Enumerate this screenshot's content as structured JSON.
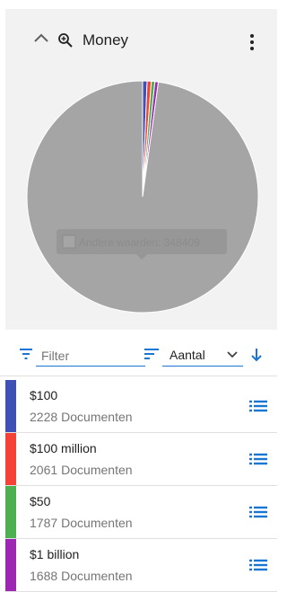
{
  "widget": {
    "title": "Money",
    "collapse_icon": "chevron-up-icon",
    "search_icon": "zoom-in-icon",
    "menu_icon": "more-vert-icon"
  },
  "pie": {
    "tooltip": "Andere waarden: 348409",
    "other_color": "#a5a5a5",
    "slice_colors": [
      "#3f51b5",
      "#f44336",
      "#4caf50",
      "#9c27b0"
    ]
  },
  "toolbar": {
    "filter_placeholder": "Filter",
    "sort_label": "Aantal",
    "accent": "#1976d2"
  },
  "count_suffix": "Documenten",
  "items": [
    {
      "label": "$100",
      "count": "2228",
      "color": "#3f51b5"
    },
    {
      "label": "$100 million",
      "count": "2061",
      "color": "#f44336"
    },
    {
      "label": "$50",
      "count": "1787",
      "color": "#4caf50"
    },
    {
      "label": "$1 billion",
      "count": "1688",
      "color": "#9c27b0"
    }
  ]
}
